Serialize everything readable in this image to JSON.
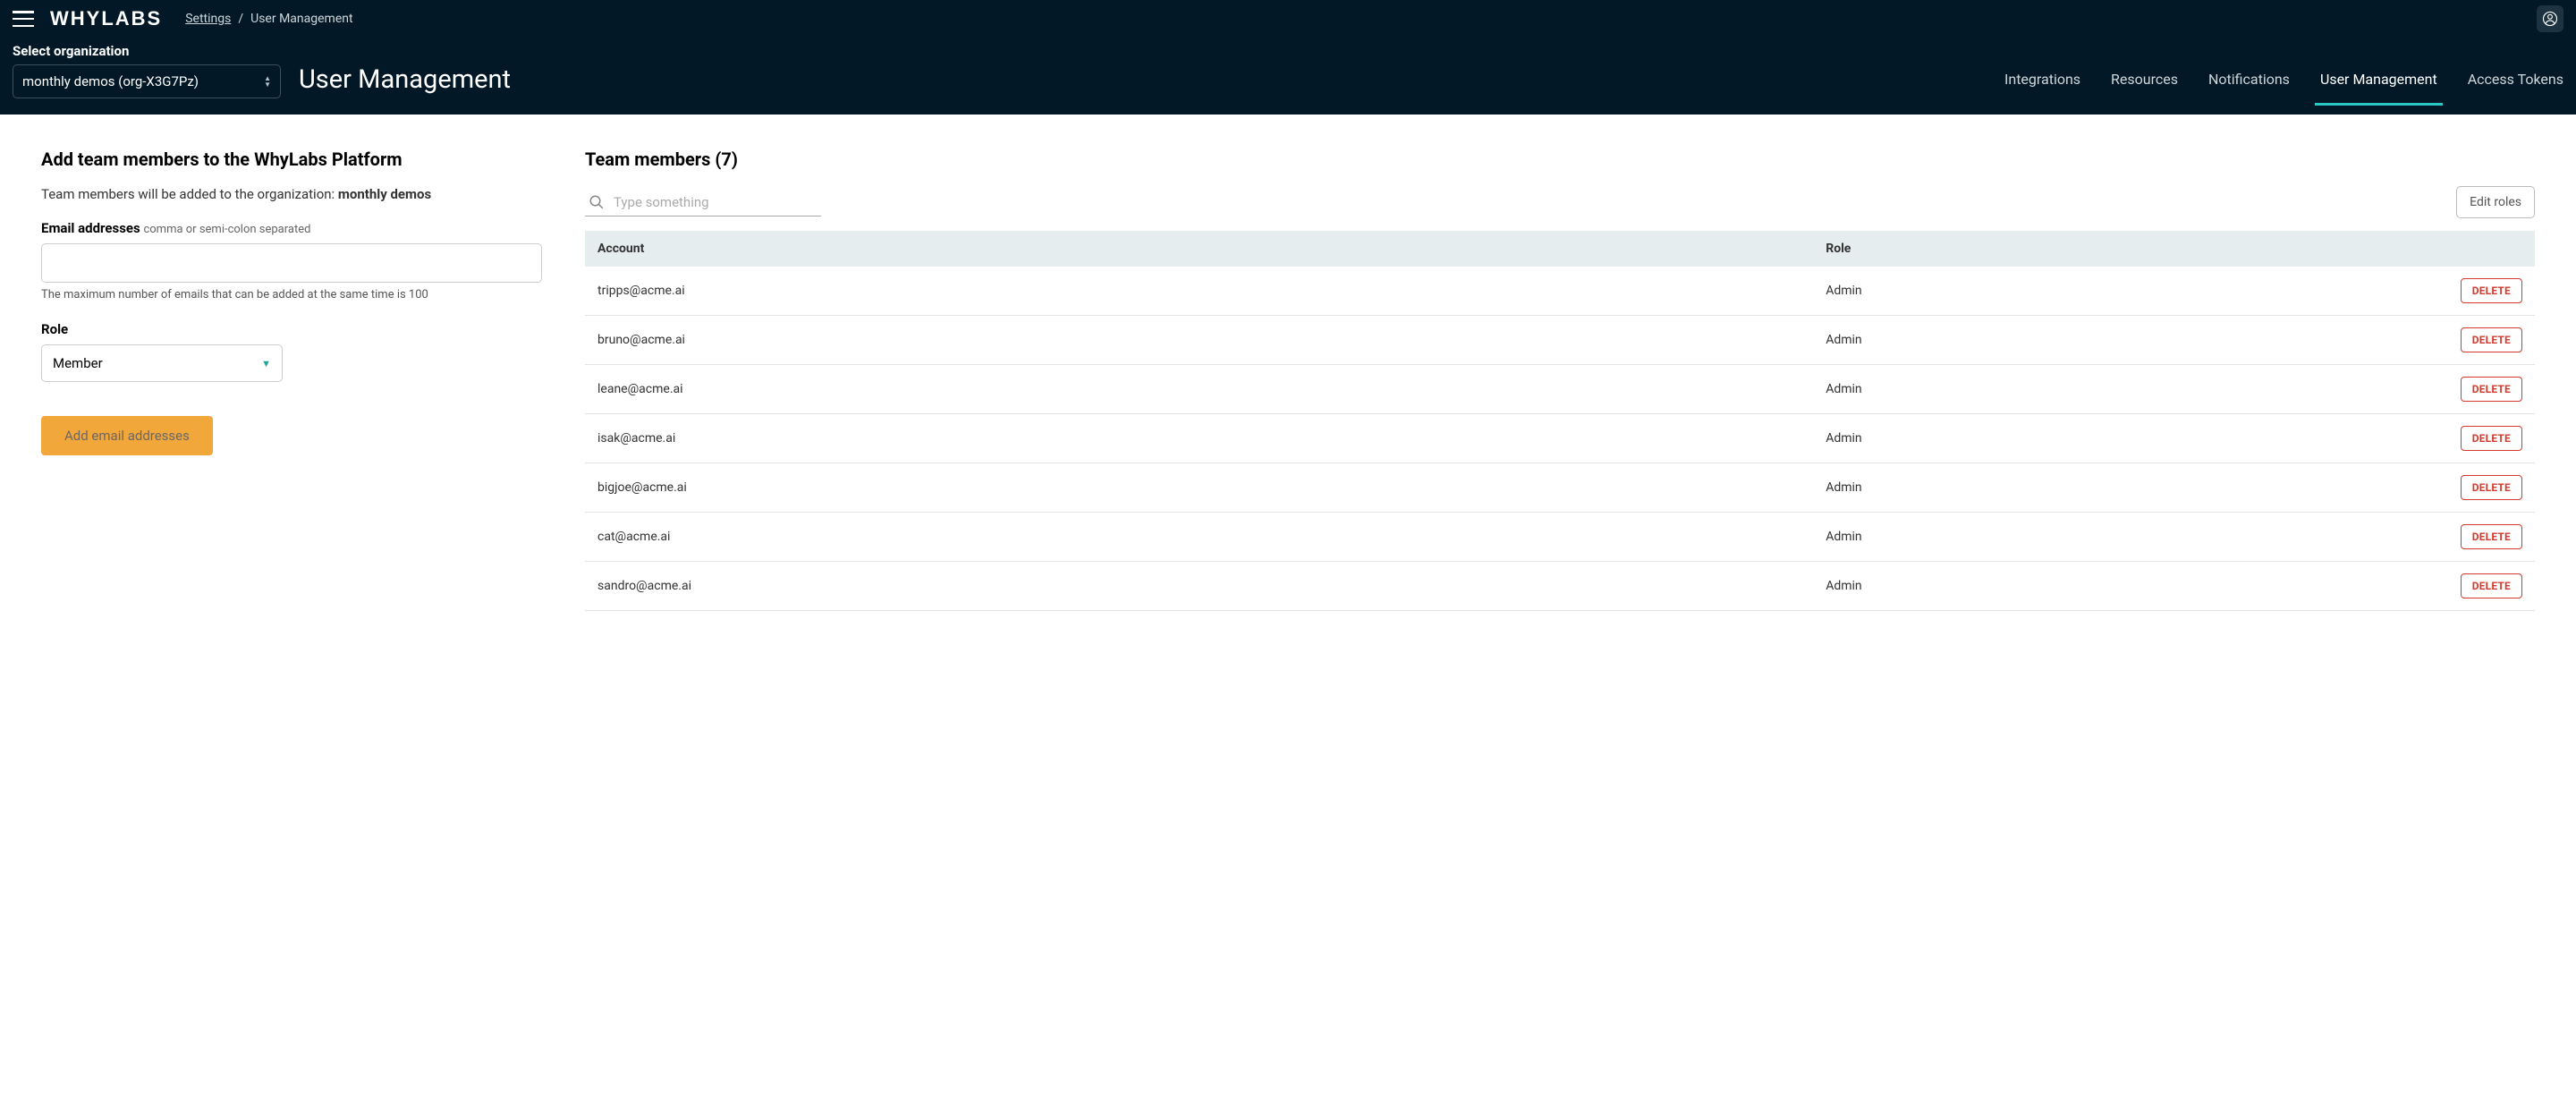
{
  "header": {
    "logo": "WHYLABS",
    "breadcrumb": {
      "settings": "Settings",
      "sep": "/",
      "current": "User Management"
    },
    "org_label": "Select organization",
    "org_value": "monthly demos (org-X3G7Pz)",
    "page_title": "User Management",
    "tabs": [
      {
        "label": "Integrations",
        "active": false
      },
      {
        "label": "Resources",
        "active": false
      },
      {
        "label": "Notifications",
        "active": false
      },
      {
        "label": "User Management",
        "active": true
      },
      {
        "label": "Access Tokens",
        "active": false
      }
    ]
  },
  "add_form": {
    "title": "Add team members to the WhyLabs Platform",
    "desc_prefix": "Team members will be added to the organization: ",
    "desc_org": "monthly demos",
    "email_label": "Email addresses",
    "email_hint": "comma or semi-colon separated",
    "email_helper": "The maximum number of emails that can be added at the same time is 100",
    "role_label": "Role",
    "role_value": "Member",
    "submit": "Add email addresses"
  },
  "members": {
    "title": "Team members (7)",
    "search_placeholder": "Type something",
    "edit_roles": "Edit roles",
    "columns": {
      "account": "Account",
      "role": "Role"
    },
    "delete_label": "DELETE",
    "rows": [
      {
        "account": "tripps@acme.ai",
        "role": "Admin"
      },
      {
        "account": "bruno@acme.ai",
        "role": "Admin"
      },
      {
        "account": "leane@acme.ai",
        "role": "Admin"
      },
      {
        "account": "isak@acme.ai",
        "role": "Admin"
      },
      {
        "account": "bigjoe@acme.ai",
        "role": "Admin"
      },
      {
        "account": "cat@acme.ai",
        "role": "Admin"
      },
      {
        "account": "sandro@acme.ai",
        "role": "Admin"
      }
    ]
  }
}
